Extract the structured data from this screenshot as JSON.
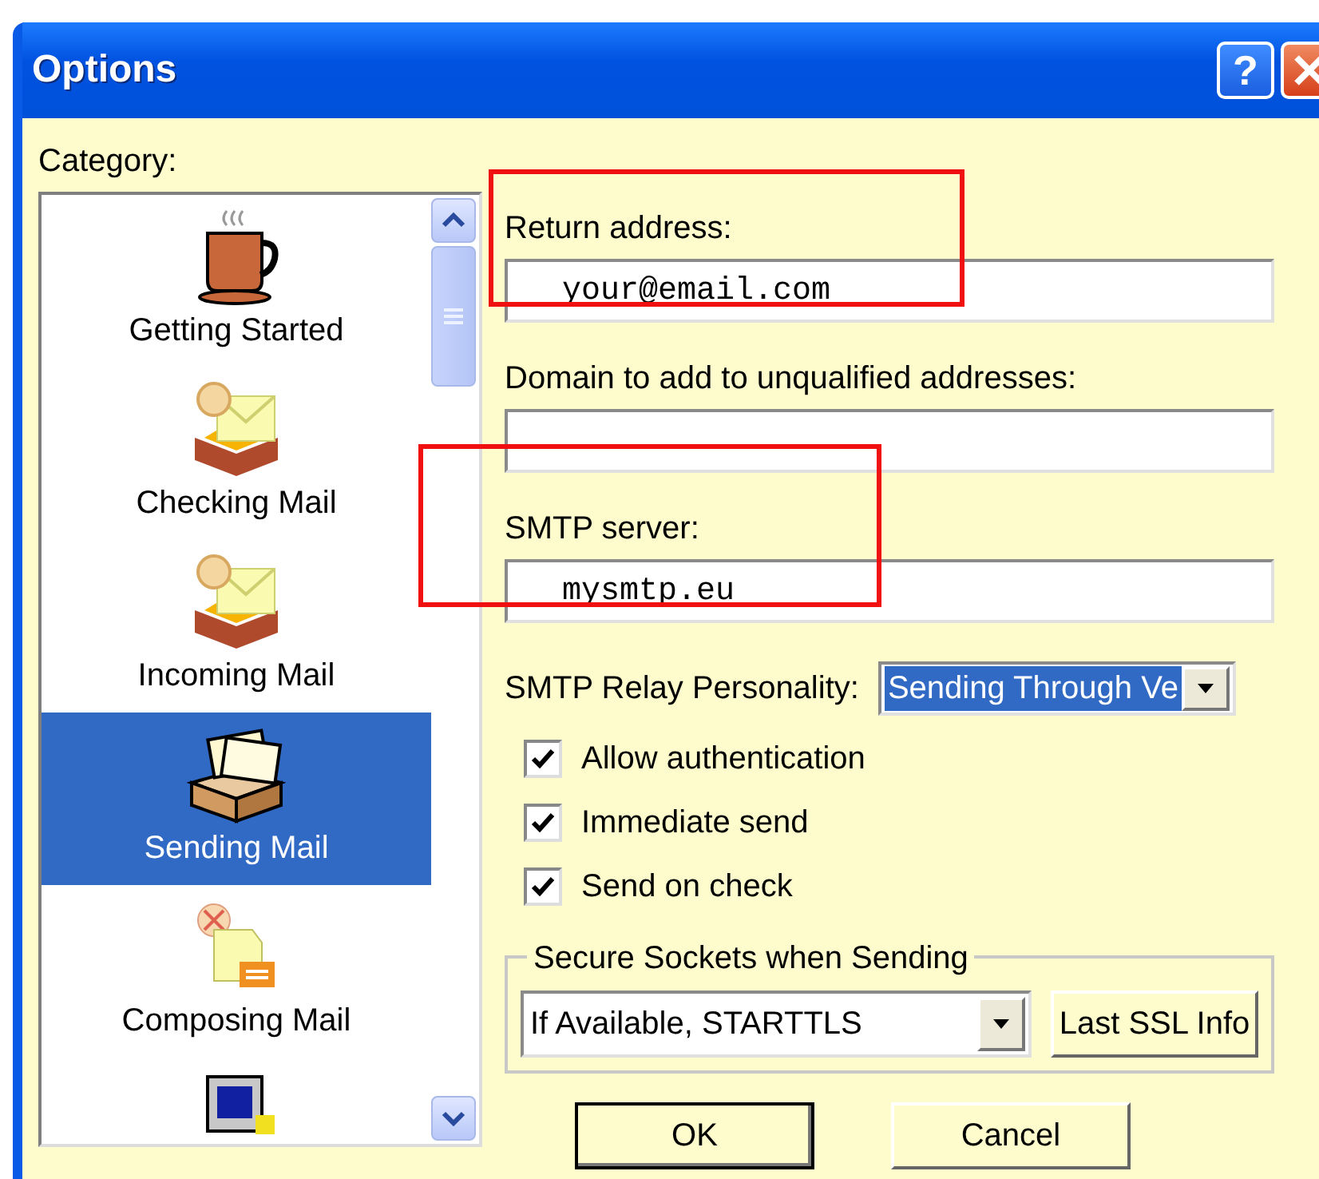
{
  "window": {
    "title": "Options",
    "help_button": "?"
  },
  "category": {
    "label": "Category:",
    "items": [
      {
        "kind": "cup",
        "label": "Getting Started",
        "selected": false
      },
      {
        "kind": "tray",
        "label": "Checking Mail",
        "selected": false
      },
      {
        "kind": "tray",
        "label": "Incoming Mail",
        "selected": false
      },
      {
        "kind": "outbox",
        "label": "Sending Mail",
        "selected": true
      },
      {
        "kind": "compose",
        "label": "Composing Mail",
        "selected": false
      },
      {
        "kind": "computer",
        "selected": false
      }
    ]
  },
  "fields": [
    {
      "label": "Return address:",
      "value": "your@email.com",
      "highlighted": true
    },
    {
      "label": "Domain to add to unqualified addresses:",
      "highlighted": false
    },
    {
      "label": "SMTP server:",
      "value": "mysmtp.eu",
      "highlighted": true
    }
  ],
  "relay": {
    "label": "SMTP Relay Personality:",
    "value": "Sending Through Ve",
    "focused": true
  },
  "checkboxes": [
    {
      "label": "Allow authentication",
      "checked": true
    },
    {
      "label": "Immediate send",
      "checked": true
    },
    {
      "label": "Send on check",
      "checked": true
    }
  ],
  "ssl_group": {
    "title": "Secure Sockets when Sending",
    "value": "If Available, STARTTLS",
    "button": "Last SSL Info"
  },
  "buttons": [
    {
      "label": "OK",
      "default": true
    },
    {
      "label": "Cancel",
      "default": false
    }
  ]
}
